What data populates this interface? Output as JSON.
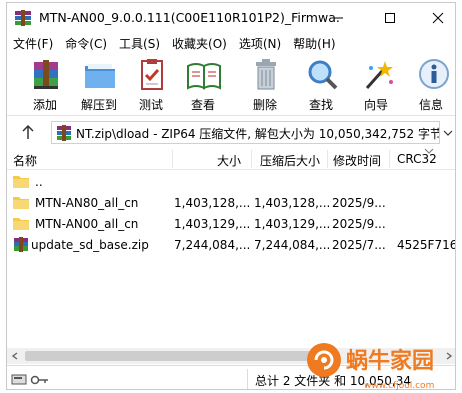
{
  "window": {
    "title": "MTN-AN00_9.0.0.111(C00E110R101P2)_Firmwa..."
  },
  "menu": [
    "文件(F)",
    "命令(C)",
    "工具(S)",
    "收藏夹(O)",
    "选项(N)",
    "帮助(H)"
  ],
  "toolbar": {
    "add": "添加",
    "extract": "解压到",
    "test": "测试",
    "view": "查看",
    "delete": "删除",
    "find": "查找",
    "wizard": "向导",
    "info": "信息"
  },
  "address": {
    "path": "NT.zip\\dload - ZIP64 压缩文件, 解包大小为 10,050,342,752 字节"
  },
  "columns": {
    "name": "名称",
    "size": "大小",
    "packed": "压缩后大小",
    "modified": "修改时间",
    "crc": "CRC32"
  },
  "files": [
    {
      "name": "..",
      "size": "",
      "packed": "",
      "modified": "",
      "crc": "",
      "type": "parent"
    },
    {
      "name": "MTN-AN80_all_cn",
      "size": "1,403,128,...",
      "packed": "1,403,128,...",
      "modified": "2025/9...",
      "crc": "",
      "type": "folder"
    },
    {
      "name": "MTN-AN00_all_cn",
      "size": "1,403,129,...",
      "packed": "1,403,129,...",
      "modified": "2025/9...",
      "crc": "",
      "type": "folder"
    },
    {
      "name": "update_sd_base.zip",
      "size": "7,244,084,...",
      "packed": "7,244,084,...",
      "modified": "2025/7...",
      "crc": "4525F716",
      "type": "archive"
    }
  ],
  "status": {
    "summary": "总计 2 文件夹 和 10,050,34"
  },
  "watermark": {
    "text": "蜗牛家园",
    "url": "www.cfjool.com"
  },
  "colors": {
    "folder": "#f5c94c",
    "watermark": "#f07a20",
    "selection": "#cce8ff"
  }
}
